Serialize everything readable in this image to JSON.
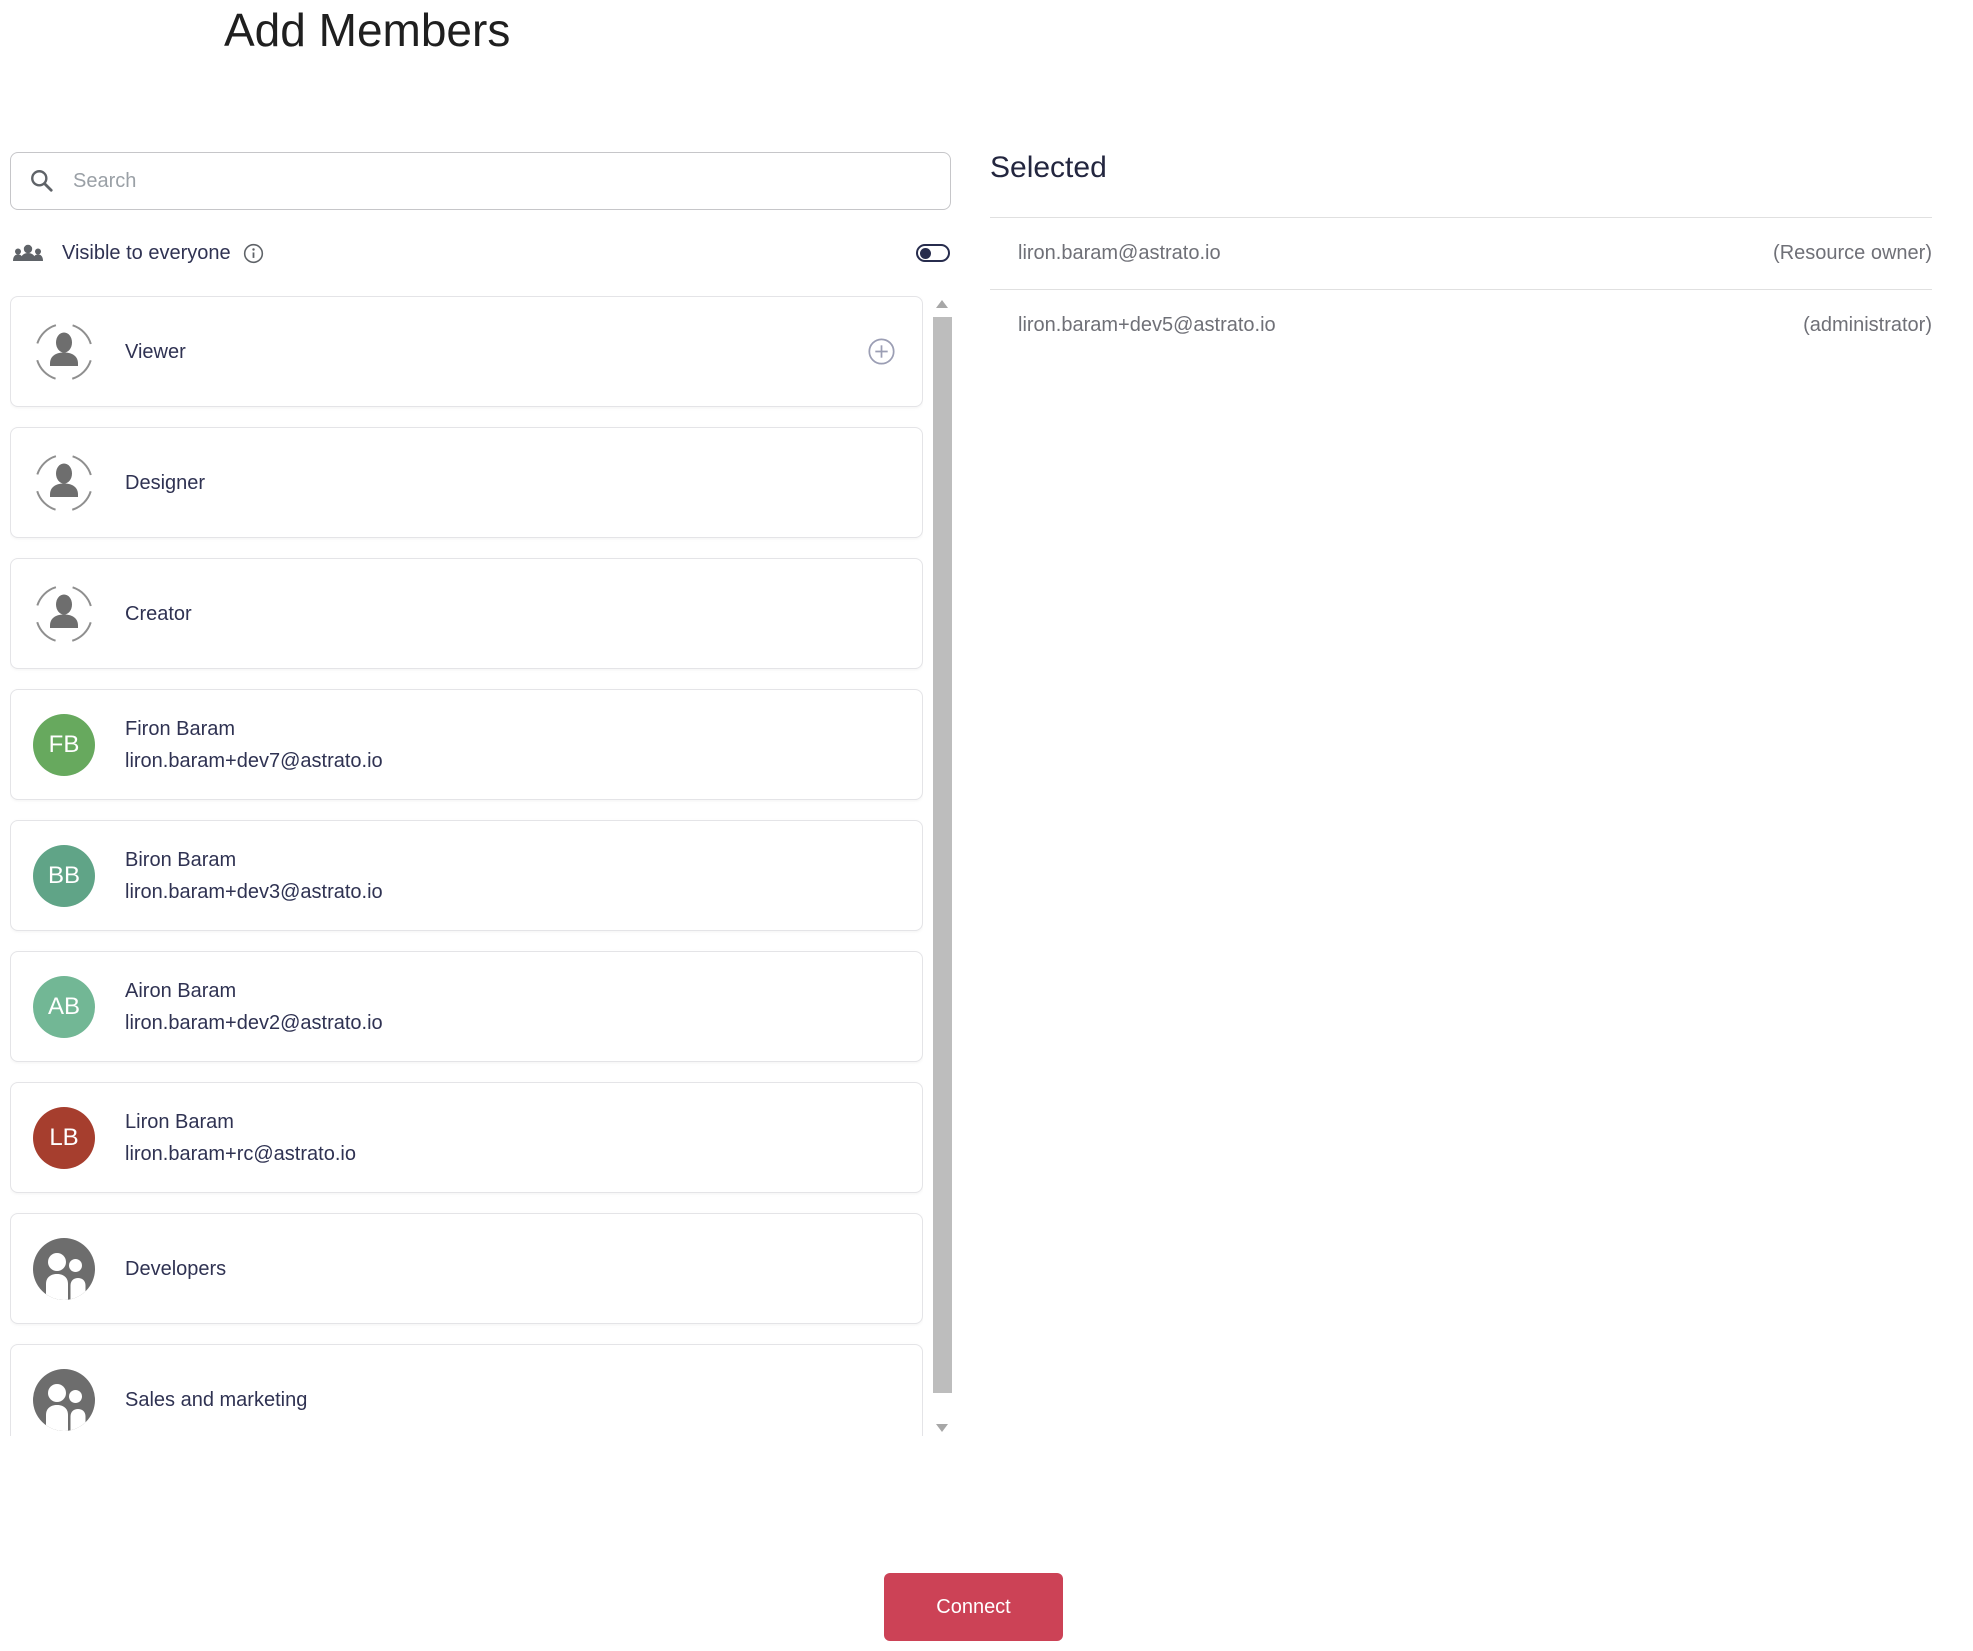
{
  "page": {
    "title": "Add Members"
  },
  "search": {
    "placeholder": "Search",
    "value": ""
  },
  "visibility": {
    "label": "Visible to everyone",
    "toggle_state": "off"
  },
  "directory": {
    "items": [
      {
        "type": "role",
        "label": "Viewer",
        "has_add_button": true
      },
      {
        "type": "role",
        "label": "Designer",
        "has_add_button": false
      },
      {
        "type": "role",
        "label": "Creator",
        "has_add_button": false
      },
      {
        "type": "user",
        "initials": "FB",
        "name": "Firon Baram",
        "email": "liron.baram+dev7@astrato.io",
        "avatar_color": "#67a95e"
      },
      {
        "type": "user",
        "initials": "BB",
        "name": "Biron Baram",
        "email": "liron.baram+dev3@astrato.io",
        "avatar_color": "#60a487"
      },
      {
        "type": "user",
        "initials": "AB",
        "name": "Airon Baram",
        "email": "liron.baram+dev2@astrato.io",
        "avatar_color": "#72b795"
      },
      {
        "type": "user",
        "initials": "LB",
        "name": "Liron Baram",
        "email": "liron.baram+rc@astrato.io",
        "avatar_color": "#a63e2e"
      },
      {
        "type": "group",
        "label": "Developers"
      },
      {
        "type": "group",
        "label": "Sales and marketing"
      }
    ]
  },
  "selected": {
    "heading": "Selected",
    "members": [
      {
        "email": "liron.baram@astrato.io",
        "role": "(Resource owner)"
      },
      {
        "email": "liron.baram+dev5@astrato.io",
        "role": "(administrator)"
      }
    ]
  },
  "footer": {
    "connect_label": "Connect"
  },
  "colors": {
    "accent_button": "#cc4256",
    "text_navy": "#2f3252",
    "text_gray": "#6f7077",
    "avatar_green": "#67a95e",
    "avatar_teal": "#60a487",
    "avatar_seafoam": "#72b795",
    "avatar_red": "#a63e2e"
  },
  "icons": {
    "search": "magnifier",
    "visibility": "groups",
    "info": "info-outline",
    "role": "person-dashed-circle",
    "group": "two-people-circle",
    "add": "plus-circle"
  }
}
